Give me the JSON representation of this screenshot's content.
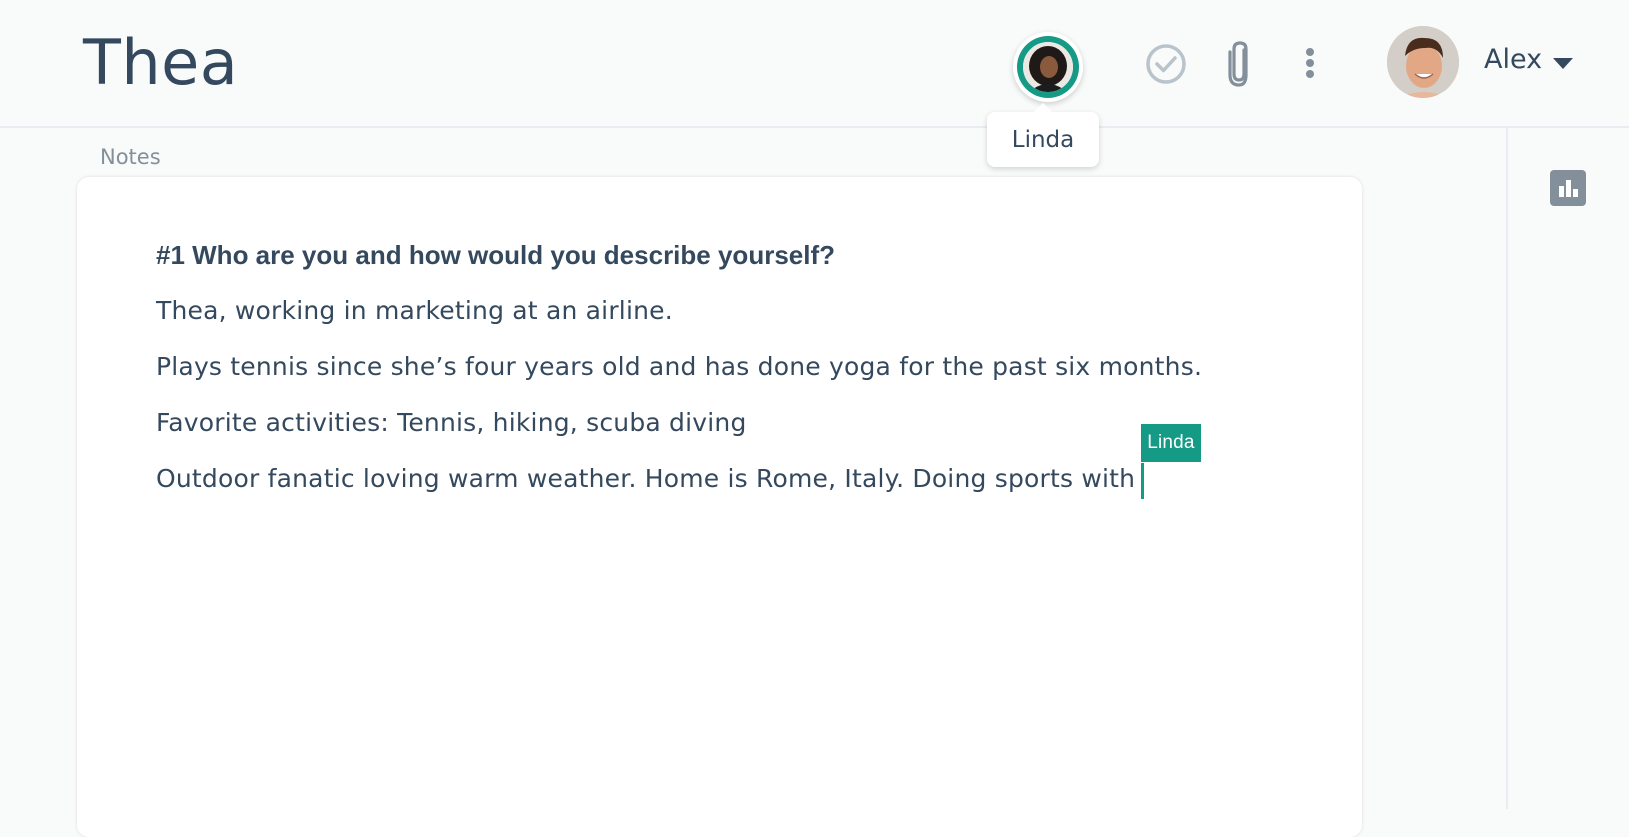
{
  "header": {
    "title": "Thea",
    "collaborator": {
      "name": "Linda",
      "tooltip": "Linda",
      "ring_color": "#159a86"
    },
    "actions": [
      {
        "name": "complete",
        "icon": "check-circle-icon"
      },
      {
        "name": "attach",
        "icon": "paperclip-icon"
      },
      {
        "name": "more",
        "icon": "kebab-menu-icon"
      }
    ],
    "user": {
      "name": "Alex",
      "menu_icon": "caret-down-icon"
    }
  },
  "side_panel": {
    "buttons": [
      {
        "name": "analytics",
        "icon": "bar-chart-icon"
      }
    ]
  },
  "notes": {
    "label": "Notes",
    "heading": "#1 Who are you and how would you describe yourself?",
    "lines": [
      "Thea, working in marketing at an airline.",
      "Plays tennis since she’s four years old and has done yoga for the past six months.",
      "Favorite activities: Tennis, hiking, scuba diving",
      "Outdoor fanatic loving warm weather. Home is Rome, Italy. Doing sports with"
    ],
    "remote_cursor": {
      "user": "Linda",
      "color": "#159a86"
    }
  },
  "colors": {
    "text": "#34495e",
    "muted": "#838f9a",
    "accent": "#159a86",
    "background": "#f9fafa"
  }
}
